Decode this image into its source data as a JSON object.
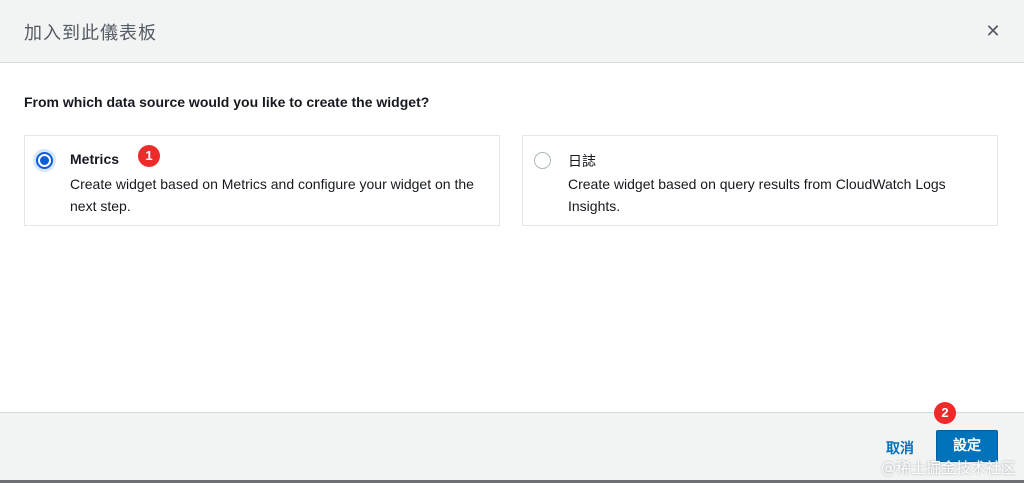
{
  "modal": {
    "title": "加入到此儀表板",
    "close_icon": "close-icon"
  },
  "question": "From which data source would you like to create the widget?",
  "options": [
    {
      "title": "Metrics",
      "description": "Create widget based on Metrics and configure your widget on the next step.",
      "selected": true
    },
    {
      "title": "日誌",
      "description": "Create widget based on query results from CloudWatch Logs Insights.",
      "selected": false
    }
  ],
  "annotations": [
    "1",
    "2"
  ],
  "footer": {
    "cancel_label": "取消",
    "confirm_label": "設定"
  },
  "watermark": "@稀土掘金技术社区",
  "colors": {
    "accent": "#0073bb",
    "radio_selected": "#0a5ed8",
    "badge": "#ee2a2a"
  }
}
